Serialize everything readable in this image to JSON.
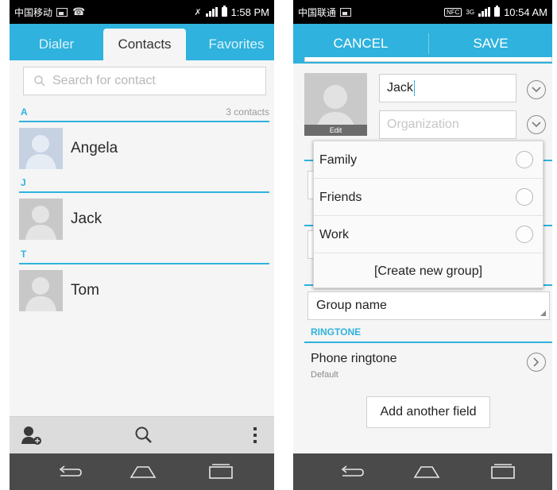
{
  "left": {
    "status": {
      "carrier": "中国移动",
      "time": "1:58 PM"
    },
    "tabs": {
      "dialer": "Dialer",
      "contacts": "Contacts",
      "favorites": "Favorites"
    },
    "search": {
      "placeholder": "Search for contact"
    },
    "sections": [
      {
        "letter": "A",
        "count": "3 contacts",
        "contact": "Angela"
      },
      {
        "letter": "J",
        "contact": "Jack"
      },
      {
        "letter": "T",
        "contact": "Tom"
      }
    ],
    "bottom_icons": [
      "add-contact-icon",
      "search-icon",
      "overflow-menu-icon"
    ]
  },
  "right": {
    "status": {
      "carrier": "中国联通",
      "nfc": "NFC",
      "network": "3G",
      "time": "10:54 AM"
    },
    "actionbar": {
      "cancel": "CANCEL",
      "save": "SAVE"
    },
    "photo": {
      "edit": "Edit"
    },
    "name_field": {
      "value": "Jack"
    },
    "organization_field": {
      "placeholder": "Organization"
    },
    "group_popup": {
      "items": [
        "Family",
        "Friends",
        "Work"
      ],
      "create": "[Create new group]"
    },
    "group_spinner": {
      "value": "Group name"
    },
    "ringtone": {
      "header": "RINGTONE",
      "title": "Phone ringtone",
      "value": "Default"
    },
    "add_field": "Add another field"
  },
  "colors": {
    "accent": "#2fb2dd",
    "navbar": "#4a4a4a",
    "bottombar": "#dcdcdc"
  }
}
